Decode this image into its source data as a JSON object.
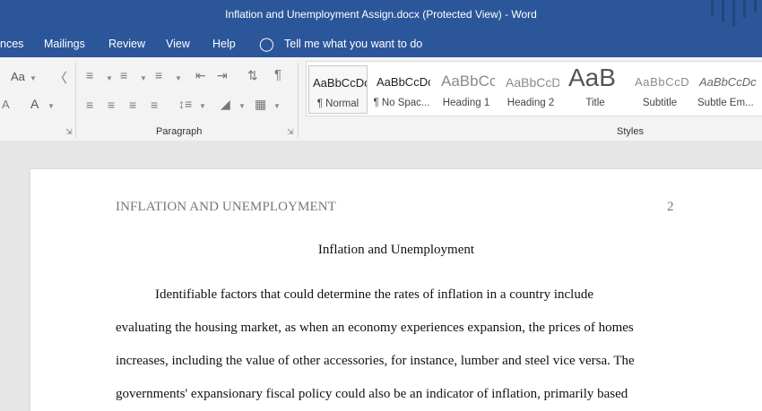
{
  "window": {
    "title": "Inflation and Unemployment Assign.docx (Protected View)  -  Word"
  },
  "menu": {
    "items": [
      "nces",
      "Mailings",
      "Review",
      "View",
      "Help"
    ],
    "tell_me": "Tell me what you want to do"
  },
  "ribbon": {
    "font_labels": {
      "case": "Aa",
      "color": "A"
    },
    "paragraph_label": "Paragraph",
    "styles_label": "Styles",
    "styles": [
      {
        "preview": "AaBbCcDc",
        "name": "¶ Normal"
      },
      {
        "preview": "AaBbCcDc",
        "name": "¶ No Spac..."
      },
      {
        "preview": "AaBbCc",
        "name": "Heading 1"
      },
      {
        "preview": "AaBbCcD",
        "name": "Heading 2"
      },
      {
        "preview": "AaB",
        "name": "Title"
      },
      {
        "preview": "AaBbCcD",
        "name": "Subtitle"
      },
      {
        "preview": "AaBbCcDc",
        "name": "Subtle Em..."
      }
    ]
  },
  "document": {
    "header_text": "INFLATION AND UNEMPLOYMENT",
    "page_number": "2",
    "title": "Inflation and Unemployment",
    "lines": [
      "Identifiable factors that could determine the rates of inflation in a country include",
      "evaluating the housing market, as when an economy experiences expansion, the prices of homes",
      "increases, including the value of other accessories, for instance, lumber and steel vice versa. The",
      "governments' expansionary fiscal policy could also be an indicator of inflation, primarily based"
    ]
  }
}
